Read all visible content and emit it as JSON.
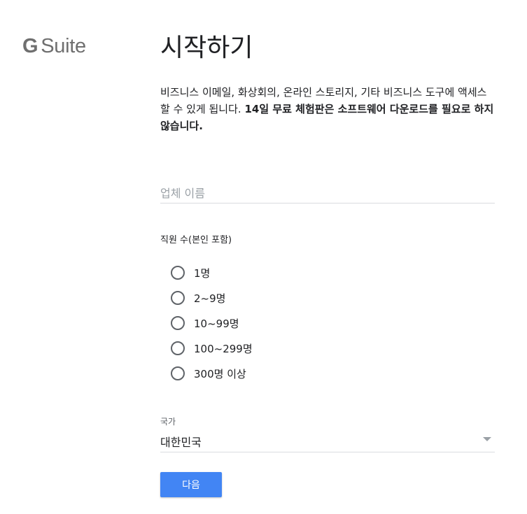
{
  "brand": {
    "g": "G",
    "suite": "Suite",
    "color": "#6f6f6f"
  },
  "page": {
    "title": "시작하기",
    "description_normal": "비즈니스 이메일, 화상회의, 온라인 스토리지, 기타 비즈니스 도구에 액세스할 수 있게 됩니다. ",
    "description_bold": "14일 무료 체험판은 소프트웨어 다운로드를 필요로 하지 않습니다."
  },
  "form": {
    "company_placeholder": "업체 이름",
    "employees_label": "직원 수(본인 포함)",
    "employee_options": [
      "1명",
      "2~9명",
      "10~99명",
      "100~299명",
      "300명 이상"
    ],
    "country_label": "국가",
    "country_value": "대한민국",
    "next_label": "다음"
  },
  "colors": {
    "accent": "#4285f4",
    "divider": "#dadce0",
    "radio_border": "#5f6368"
  }
}
